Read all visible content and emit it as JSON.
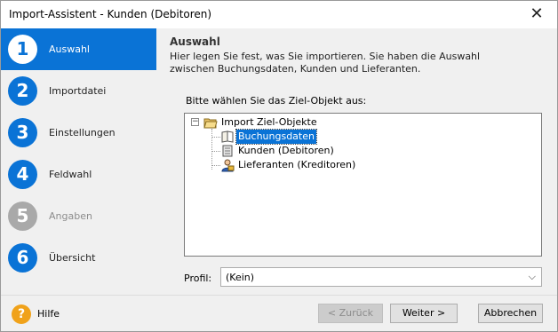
{
  "window": {
    "title": "Import-Assistent - Kunden (Debitoren)",
    "close_glyph": "✕"
  },
  "sidebar": {
    "steps": [
      {
        "number": "1",
        "label": "Auswahl",
        "state": "active"
      },
      {
        "number": "2",
        "label": "Importdatei",
        "state": "normal"
      },
      {
        "number": "3",
        "label": "Einstellungen",
        "state": "normal"
      },
      {
        "number": "4",
        "label": "Feldwahl",
        "state": "normal"
      },
      {
        "number": "5",
        "label": "Angaben",
        "state": "disabled"
      },
      {
        "number": "6",
        "label": "Übersicht",
        "state": "normal"
      }
    ]
  },
  "main": {
    "heading": "Auswahl",
    "description": "Hier legen Sie fest, was Sie importieren. Sie haben die Auswahl zwischen Buchungsdaten, Kunden und Lieferanten.",
    "prompt": "Bitte wählen Sie das Ziel-Objekt aus:",
    "tree": {
      "root": {
        "label": "Import Ziel-Objekte",
        "expander": "−",
        "icon": "open-folder-icon"
      },
      "children": [
        {
          "label": "Buchungsdaten",
          "icon": "book-icon",
          "selected": true
        },
        {
          "label": "Kunden (Debitoren)",
          "icon": "customer-card-icon",
          "selected": false
        },
        {
          "label": "Lieferanten (Kreditoren)",
          "icon": "supplier-person-icon",
          "selected": false
        }
      ]
    },
    "profile": {
      "label": "Profil:",
      "value": "(Kein)"
    }
  },
  "footer": {
    "help_glyph": "?",
    "help_label": "Hilfe",
    "back_label": "< Zurück",
    "next_label": "Weiter >",
    "cancel_label": "Abbrechen"
  },
  "colors": {
    "accent": "#0a73d6",
    "disabled": "#a9a9a9",
    "help": "#f0a21a"
  }
}
